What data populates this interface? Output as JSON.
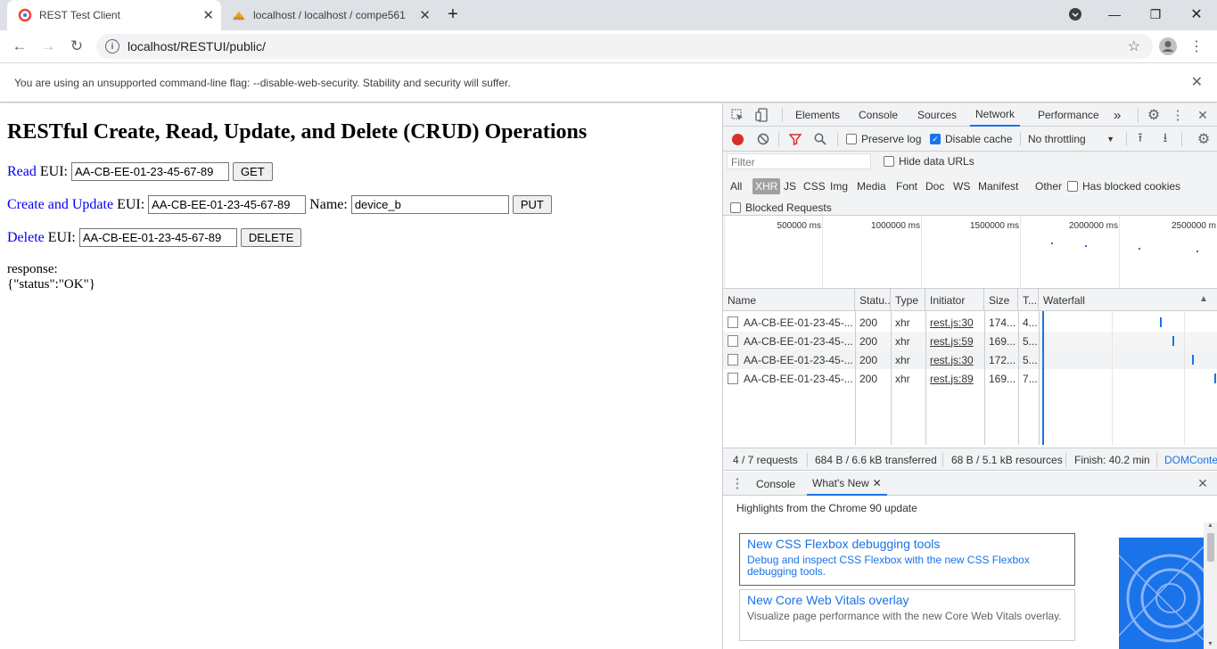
{
  "browser": {
    "tabs": [
      {
        "title": "REST Test Client",
        "active": true
      },
      {
        "title": "localhost / localhost / compe561",
        "active": false
      }
    ],
    "new_tab_label": "+",
    "url": "localhost/RESTUI/public/",
    "infobar_message": "You are using an unsupported command-line flag: --disable-web-security. Stability and security will suffer.",
    "accent_color": "#1a73e8"
  },
  "page": {
    "heading": "RESTful Create, Read, Update, and Delete (CRUD) Operations",
    "read": {
      "link": "Read",
      "label": "EUI:",
      "value": "AA-CB-EE-01-23-45-67-89",
      "button": "GET"
    },
    "create": {
      "link": "Create and Update",
      "label": "EUI:",
      "value": "AA-CB-EE-01-23-45-67-89",
      "name_label": "Name:",
      "name_value": "device_b",
      "button": "PUT"
    },
    "delete": {
      "link": "Delete",
      "label": "EUI:",
      "value": "AA-CB-EE-01-23-45-67-89",
      "button": "DELETE"
    },
    "response_label": "response:",
    "response_body": "{\"status\":\"OK\"}"
  },
  "devtools": {
    "panels": [
      "Elements",
      "Console",
      "Sources",
      "Network",
      "Performance"
    ],
    "selected_panel": "Network",
    "more_label": "»",
    "toolbar": {
      "preserve_log": "Preserve log",
      "disable_cache": "Disable cache",
      "throttling": "No throttling"
    },
    "filter": {
      "placeholder": "Filter",
      "hide_data_urls": "Hide data URLs",
      "types": [
        "All",
        "XHR",
        "JS",
        "CSS",
        "Img",
        "Media",
        "Font",
        "Doc",
        "WS",
        "Manifest",
        "Other"
      ],
      "selected_type": "XHR",
      "has_blocked_cookies": "Has blocked cookies",
      "blocked_requests": "Blocked Requests"
    },
    "overview_ticks": [
      "500000 ms",
      "1000000 ms",
      "1500000 ms",
      "2000000 ms",
      "2500000 m"
    ],
    "columns": [
      "Name",
      "Statu...",
      "Type",
      "Initiator",
      "Size",
      "T...",
      "Waterfall"
    ],
    "requests": [
      {
        "name": "AA-CB-EE-01-23-45-...",
        "status": "200",
        "type": "xhr",
        "initiator": "rest.js:30",
        "size": "174...",
        "time": "4..."
      },
      {
        "name": "AA-CB-EE-01-23-45-...",
        "status": "200",
        "type": "xhr",
        "initiator": "rest.js:59",
        "size": "169...",
        "time": "5..."
      },
      {
        "name": "AA-CB-EE-01-23-45-...",
        "status": "200",
        "type": "xhr",
        "initiator": "rest.js:30",
        "size": "172...",
        "time": "5..."
      },
      {
        "name": "AA-CB-EE-01-23-45-...",
        "status": "200",
        "type": "xhr",
        "initiator": "rest.js:89",
        "size": "169...",
        "time": "7..."
      }
    ],
    "status": {
      "requests": "4 / 7 requests",
      "transferred": "684 B / 6.6 kB transferred",
      "resources": "68 B / 5.1 kB resources",
      "finish": "Finish: 40.2 min",
      "domcontent": "DOMConte"
    },
    "drawer": {
      "tabs": [
        "Console",
        "What's New"
      ],
      "selected_tab": "What's New",
      "highlights": "Highlights from the Chrome 90 update",
      "cards": [
        {
          "title": "New CSS Flexbox debugging tools",
          "desc": "Debug and inspect CSS Flexbox with the new CSS Flexbox debugging tools."
        },
        {
          "title": "New Core Web Vitals overlay",
          "desc": "Visualize page performance with the new Core Web Vitals overlay."
        }
      ]
    }
  }
}
